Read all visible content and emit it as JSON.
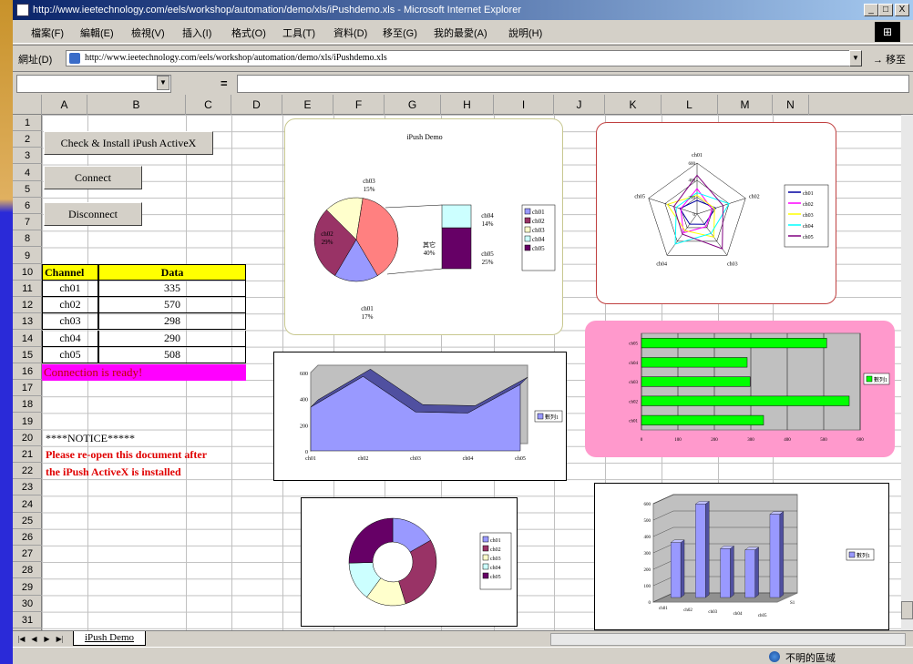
{
  "window": {
    "title": "http://www.ieetechnology.com/eels/workshop/automation/demo/xls/iPushdemo.xls - Microsoft Internet Explorer",
    "controls": [
      "_",
      "□",
      "X"
    ]
  },
  "menu": [
    "檔案(F)",
    "編輯(E)",
    "檢視(V)",
    "插入(I)",
    "格式(O)",
    "工具(T)",
    "資料(D)",
    "移至(G)",
    "我的最愛(A)",
    "說明(H)"
  ],
  "address": {
    "label": "網址(D)",
    "url": "http://www.ieetechnology.com/eels/workshop/automation/demo/xls/iPushdemo.xls",
    "go": "移至"
  },
  "formula": {
    "eq": "="
  },
  "columns": [
    "A",
    "B",
    "C",
    "D",
    "E",
    "F",
    "G",
    "H",
    "I",
    "J",
    "K",
    "L",
    "M",
    "N"
  ],
  "rows": [
    "1",
    "2",
    "3",
    "4",
    "5",
    "6",
    "7",
    "8",
    "9",
    "10",
    "11",
    "12",
    "13",
    "14",
    "15",
    "16",
    "17",
    "18",
    "19",
    "20",
    "21",
    "22",
    "23",
    "24",
    "25",
    "26",
    "27",
    "28",
    "29",
    "30",
    "31"
  ],
  "buttons": {
    "install": "Check & Install iPush ActiveX",
    "connect": "Connect",
    "disconnect": "Disconnect"
  },
  "table": {
    "headers": [
      "Channel",
      "Data"
    ],
    "rows": [
      [
        "ch01",
        "335"
      ],
      [
        "ch02",
        "570"
      ],
      [
        "ch03",
        "298"
      ],
      [
        "ch04",
        "290"
      ],
      [
        "ch05",
        "508"
      ]
    ]
  },
  "status": "Connection is ready!",
  "notice": {
    "title": "****NOTICE*****",
    "line1": "Please re-open this document after",
    "line2": "the iPush ActiveX is installed"
  },
  "chart_data": [
    {
      "type": "pie",
      "title": "iPush Demo",
      "categories": [
        "ch01",
        "ch02",
        "ch03",
        "ch04",
        "ch05"
      ],
      "values": [
        17,
        29,
        15,
        14,
        25
      ],
      "labels": [
        "ch01 17%",
        "ch02 29%",
        "ch03 15%",
        "其它 40%",
        "ch04 14%",
        "ch05 25%"
      ],
      "legend": [
        "ch01",
        "ch02",
        "ch03",
        "ch04",
        "ch05"
      ]
    },
    {
      "type": "radar",
      "categories": [
        "ch01",
        "ch02",
        "ch03",
        "ch04",
        "ch05"
      ],
      "ticks": [
        "0",
        "200",
        "400",
        "600"
      ],
      "legend": [
        "ch01",
        "ch02",
        "ch03",
        "ch04",
        "ch05"
      ],
      "colors": [
        "#0000a0",
        "#ff00ff",
        "#ffff00",
        "#00ffff",
        "#800080"
      ]
    },
    {
      "type": "area",
      "categories": [
        "ch01",
        "ch02",
        "ch03",
        "ch04",
        "ch05"
      ],
      "values": [
        335,
        570,
        298,
        290,
        508
      ],
      "ylim": [
        0,
        600
      ],
      "yticks": [
        "0",
        "200",
        "400",
        "600"
      ],
      "legend": [
        "數列1"
      ]
    },
    {
      "type": "bar",
      "orientation": "horizontal",
      "categories": [
        "ch01",
        "ch02",
        "ch03",
        "ch04",
        "ch05"
      ],
      "values": [
        335,
        570,
        298,
        290,
        508
      ],
      "xlim": [
        0,
        600
      ],
      "xticks": [
        "0",
        "100",
        "200",
        "300",
        "400",
        "500",
        "600"
      ],
      "legend": [
        "數列1"
      ]
    },
    {
      "type": "pie",
      "variant": "doughnut",
      "categories": [
        "ch01",
        "ch02",
        "ch03",
        "ch04",
        "ch05"
      ],
      "values": [
        335,
        570,
        298,
        290,
        508
      ],
      "legend": [
        "ch01",
        "ch02",
        "ch03",
        "ch04",
        "ch05"
      ]
    },
    {
      "type": "bar",
      "variant": "3d-column",
      "categories": [
        "ch01",
        "ch02",
        "ch03",
        "ch04",
        "ch05"
      ],
      "values": [
        335,
        570,
        298,
        290,
        508
      ],
      "ylim": [
        0,
        600
      ],
      "yticks": [
        "0",
        "100",
        "200",
        "300",
        "400",
        "500",
        "600"
      ],
      "legend": [
        "數列1"
      ],
      "zlabel": "S1"
    }
  ],
  "sheet_tab": "iPush Demo",
  "statusbar": {
    "zone": "不明的區域"
  },
  "colors": {
    "pie": [
      "#9999ff",
      "#993366",
      "#ffffcc",
      "#ccffff",
      "#660066"
    ],
    "bar_green": "#00ff00",
    "area_fill": "#9999ff",
    "pink_bg": "#ff99cc",
    "header_yellow": "#ffff00",
    "status_magenta": "#ff00ff"
  }
}
